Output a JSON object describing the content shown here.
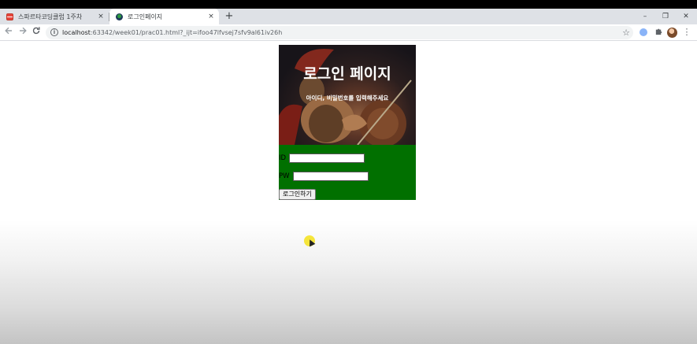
{
  "browser": {
    "tabs": [
      {
        "title": "스파르타코딩클럽 1주차",
        "active": false
      },
      {
        "title": "로그인페이지",
        "active": true
      }
    ],
    "close_glyph": "×",
    "new_tab_glyph": "+",
    "window_controls": {
      "minimize": "–",
      "restore": "❐",
      "close": "✕"
    },
    "address": {
      "host": "localhost",
      "path": ":63342/week01/prac01.html?_ijt=ifoo47lfvsej7sfv9al61iv26h"
    },
    "icons": [
      "back-arrow-icon",
      "forward-arrow-icon",
      "reload-icon",
      "info-icon",
      "bookmark-star-icon",
      "extension-icon",
      "puzzle-icon",
      "profile-avatar",
      "menu-dots-icon"
    ]
  },
  "page": {
    "hero_title": "로그인 페이지",
    "hero_subtitle": "아이디, 비밀번호를 입력해주세요",
    "id_label": "ID",
    "pw_label": "PW",
    "id_value": "",
    "pw_value": "",
    "login_button": "로그인하기"
  },
  "colors": {
    "form_background": "#017000",
    "cursor_highlight": "#f4e21a"
  }
}
